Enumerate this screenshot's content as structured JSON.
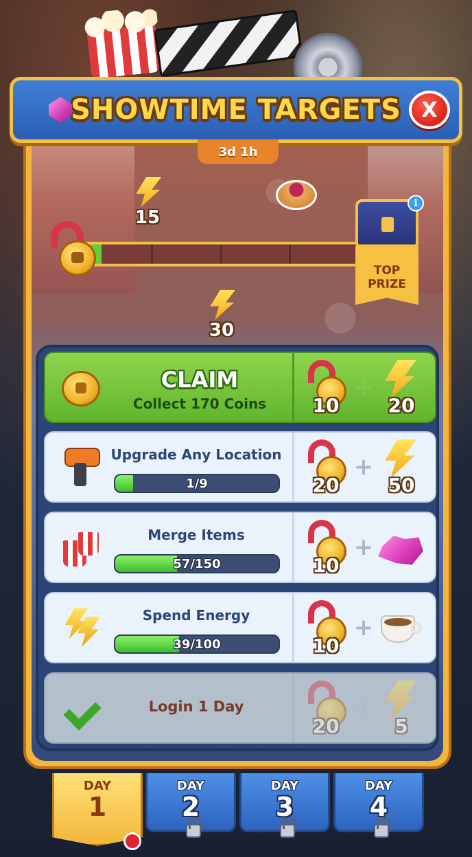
{
  "header": {
    "title": "SHOWTIME TARGETS",
    "close_label": "X",
    "timer": "3d 1h"
  },
  "track": {
    "milestones": [
      {
        "icon": "energy-bolt-icon",
        "amount": "15"
      },
      {
        "icon": "pancake-icon",
        "amount": ""
      },
      {
        "icon": "energy-bolt-icon",
        "amount": "30"
      }
    ],
    "progress_fraction": 0.06,
    "top_prize_label": "TOP PRIZE",
    "info_label": "i"
  },
  "tasks": [
    {
      "type": "claim",
      "title": "CLAIM",
      "subtitle": "Collect 170 Coins",
      "icon": "coin-icon",
      "reward_medal": "10",
      "reward_second": {
        "icon": "energy-bolt-icon",
        "amount": "20"
      }
    },
    {
      "type": "progress",
      "title": "Upgrade Any Location",
      "icon": "drill-icon",
      "progress_label": "1/9",
      "progress_fraction": 0.111,
      "reward_medal": "20",
      "reward_second": {
        "icon": "energy-bolt-icon",
        "amount": "50"
      }
    },
    {
      "type": "progress",
      "title": "Merge Items",
      "icon": "popcorn-merge-icon",
      "progress_label": "57/150",
      "progress_fraction": 0.38,
      "reward_medal": "10",
      "reward_second": {
        "icon": "gem-icon",
        "amount": ""
      }
    },
    {
      "type": "progress",
      "title": "Spend Energy",
      "icon": "energy-icon",
      "progress_label": "39/100",
      "progress_fraction": 0.39,
      "reward_medal": "10",
      "reward_second": {
        "icon": "coffee-icon",
        "amount": ""
      }
    },
    {
      "type": "done",
      "title": "Login 1 Day",
      "icon": "check-icon",
      "reward_medal": "20",
      "reward_second": {
        "icon": "energy-bolt-icon",
        "amount": "5"
      }
    }
  ],
  "days": [
    {
      "label": "DAY",
      "number": "1",
      "active": true
    },
    {
      "label": "DAY",
      "number": "2",
      "active": false
    },
    {
      "label": "DAY",
      "number": "3",
      "active": false
    },
    {
      "label": "DAY",
      "number": "4",
      "active": false
    }
  ],
  "colors": {
    "banner": "#2b5fb5",
    "gold": "#f4c146",
    "claim_green": "#5fb52c",
    "close_red": "#d8261c"
  }
}
